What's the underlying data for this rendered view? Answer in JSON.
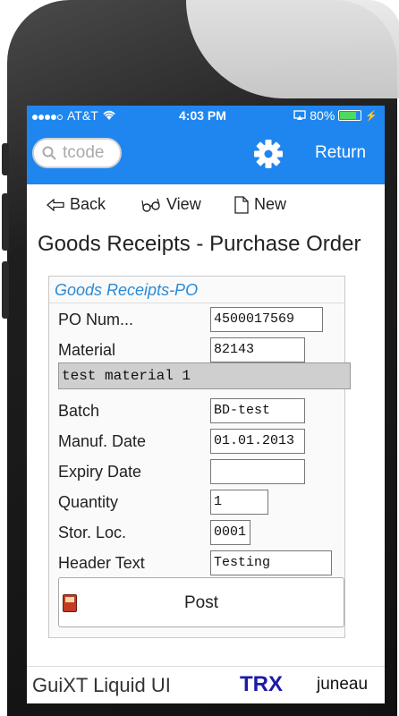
{
  "status_bar": {
    "carrier": "AT&T",
    "time": "4:03 PM",
    "battery": "80%"
  },
  "nav": {
    "search_placeholder": "tcode",
    "return_label": "Return",
    "settings_icon": "gear-icon"
  },
  "toolbar": {
    "back_label": "Back",
    "view_label": "View",
    "new_label": "New"
  },
  "page": {
    "title": "Goods Receipts - Purchase Order"
  },
  "form": {
    "header": "Goods Receipts-PO",
    "po_num_label": "PO Num...",
    "po_num_value": "4500017569",
    "material_label": "Material",
    "material_value": "82143",
    "material_desc": "test material 1",
    "batch_label": "Batch",
    "batch_value": "BD-test",
    "manuf_date_label": "Manuf. Date",
    "manuf_date_value": "01.01.2013",
    "expiry_date_label": "Expiry Date",
    "expiry_date_value": "",
    "quantity_label": "Quantity",
    "quantity_value": "1",
    "stor_loc_label": "Stor. Loc.",
    "stor_loc_value": "0001",
    "header_text_label": "Header Text",
    "header_text_value": "Testing",
    "post_label": "Post"
  },
  "footer": {
    "brand": "GuiXT Liquid UI",
    "trx": "TRX",
    "system": "juneau"
  },
  "colors": {
    "accent": "#1f86f0",
    "panel_header": "#2a8ad6",
    "trx": "#1b1ba8"
  }
}
